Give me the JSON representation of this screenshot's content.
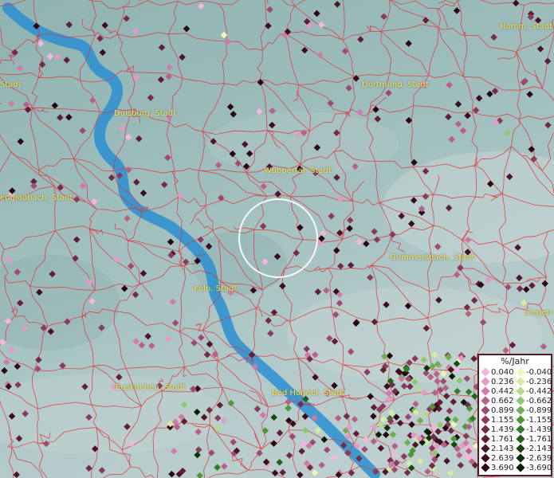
{
  "map": {
    "cities": [
      {
        "id": "hamm",
        "label": "Hamm, Stadt"
      },
      {
        "id": "stadt-left",
        "label": "Stadt"
      },
      {
        "id": "dortmund",
        "label": "Dortmund, Stadt"
      },
      {
        "id": "duisburg",
        "label": "Duisburg, Stadt"
      },
      {
        "id": "wuppertal",
        "label": "Wuppertal, Stadt"
      },
      {
        "id": "moenchengladbach",
        "label": "engladbach, Stadt"
      },
      {
        "id": "gummersbach",
        "label": "Gummersbach, Stadt"
      },
      {
        "id": "koeln",
        "label": "Köln, Stadt"
      },
      {
        "id": "siegen",
        "label": "Siegen"
      },
      {
        "id": "euskirchen",
        "label": "Euskirchen, Stadt"
      },
      {
        "id": "bad-honnef",
        "label": "Bad Honnef, Stadt"
      }
    ],
    "colors": {
      "river": "#2a8fd0",
      "borders": "#e0303a",
      "highlight_circle": "#ffffff"
    }
  },
  "legend": {
    "title": "%/Jahr",
    "positive": [
      {
        "value": "0.040",
        "color": "#f4b8e0"
      },
      {
        "value": "0.236",
        "color": "#e49ac6"
      },
      {
        "value": "0.442",
        "color": "#d07aa8"
      },
      {
        "value": "0.662",
        "color": "#b8608a"
      },
      {
        "value": "0.899",
        "color": "#a04a72"
      },
      {
        "value": "1.155",
        "color": "#8a3a5c"
      },
      {
        "value": "1.439",
        "color": "#742a48"
      },
      {
        "value": "1.761",
        "color": "#601e38"
      },
      {
        "value": "2.143",
        "color": "#4c142a"
      },
      {
        "value": "2.639",
        "color": "#3a0c1e"
      },
      {
        "value": "3.690",
        "color": "#280612"
      }
    ],
    "negative": [
      {
        "value": "-0.040",
        "color": "#f0f5b8"
      },
      {
        "value": "-0.236",
        "color": "#d6eca4"
      },
      {
        "value": "-0.442",
        "color": "#b4dc8a"
      },
      {
        "value": "-0.662",
        "color": "#8ec86c"
      },
      {
        "value": "-0.899",
        "color": "#6cb050"
      },
      {
        "value": "-1.155",
        "color": "#4e963a"
      },
      {
        "value": "-1.439",
        "color": "#367c28"
      },
      {
        "value": "-1.761",
        "color": "#22621a"
      },
      {
        "value": "-2.143",
        "color": "#144a10"
      },
      {
        "value": "-2.639",
        "color": "#0a3408"
      },
      {
        "value": "-3.690",
        "color": "#041e04"
      }
    ]
  }
}
